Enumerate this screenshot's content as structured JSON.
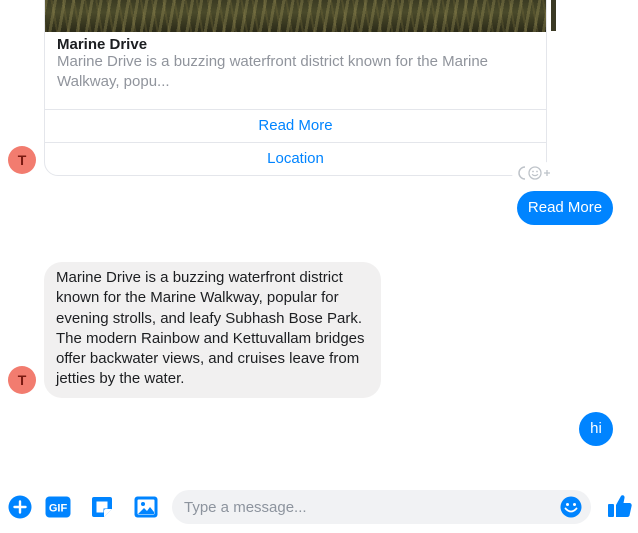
{
  "card": {
    "title": "Marine Drive",
    "description": "Marine Drive is a buzzing waterfront district known for the Marine Walkway, popu...",
    "buttons": [
      "Read More",
      "Location"
    ]
  },
  "avatar_letter": "T",
  "messages": {
    "outgoing_read_more": "Read More",
    "incoming_text": "Marine Drive is a buzzing waterfront district known for the Marine Walkway, popular for evening strolls, and leafy Subhash Bose Park. The modern Rainbow and Kettuvallam bridges offer backwater views, and cruises leave from jetties by the water.",
    "outgoing_hi": "hi"
  },
  "composer": {
    "placeholder": "Type a message...",
    "icons": [
      "plus-icon",
      "gif-icon",
      "sticker-icon",
      "image-icon",
      "emoji-icon",
      "thumbs-up-icon"
    ]
  },
  "colors": {
    "accent": "#0084ff",
    "incoming_bubble": "#f1f0f0",
    "avatar": "#f27c6f"
  }
}
